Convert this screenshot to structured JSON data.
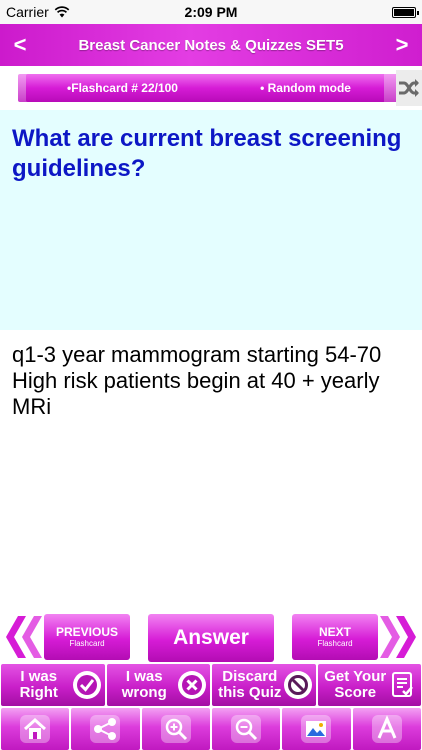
{
  "status_bar": {
    "carrier": "Carrier",
    "time": "2:09 PM"
  },
  "nav": {
    "title": "Breast Cancer  Notes & Quizzes SET5",
    "back_icon": "chevron-left-icon",
    "forward_icon": "chevron-right-icon"
  },
  "info": {
    "flashcard": "•Flashcard #  22/100",
    "mode": "• Random mode",
    "shuffle_icon": "shuffle-icon"
  },
  "question": {
    "text": "What are current breast screening guidelines?"
  },
  "answer": {
    "text": "q1-3 year mammogram starting 54-70\nHigh risk patients begin at 40 + yearly MRi"
  },
  "controls": {
    "previous_label": "PREVIOUS",
    "previous_sub": "Flashcard",
    "answer_label": "Answer",
    "next_label": "NEXT",
    "next_sub": "Flashcard"
  },
  "actions": [
    {
      "label": "I was\nRight",
      "icon": "check-icon"
    },
    {
      "label": "I was\nwrong",
      "icon": "cross-icon"
    },
    {
      "label": "Discard\nthis Quiz",
      "icon": "prohibited-icon"
    },
    {
      "label": "Get Your\nScore",
      "icon": "score-icon"
    }
  ],
  "tabs": [
    {
      "icon": "home-icon"
    },
    {
      "icon": "share-icon"
    },
    {
      "icon": "zoom-in-icon"
    },
    {
      "icon": "zoom-out-icon"
    },
    {
      "icon": "photo-icon"
    },
    {
      "icon": "font-size-icon"
    }
  ],
  "colors": {
    "accent": "#d61cd6",
    "question_bg": "#e4feff",
    "question_text": "#0d17c5"
  }
}
